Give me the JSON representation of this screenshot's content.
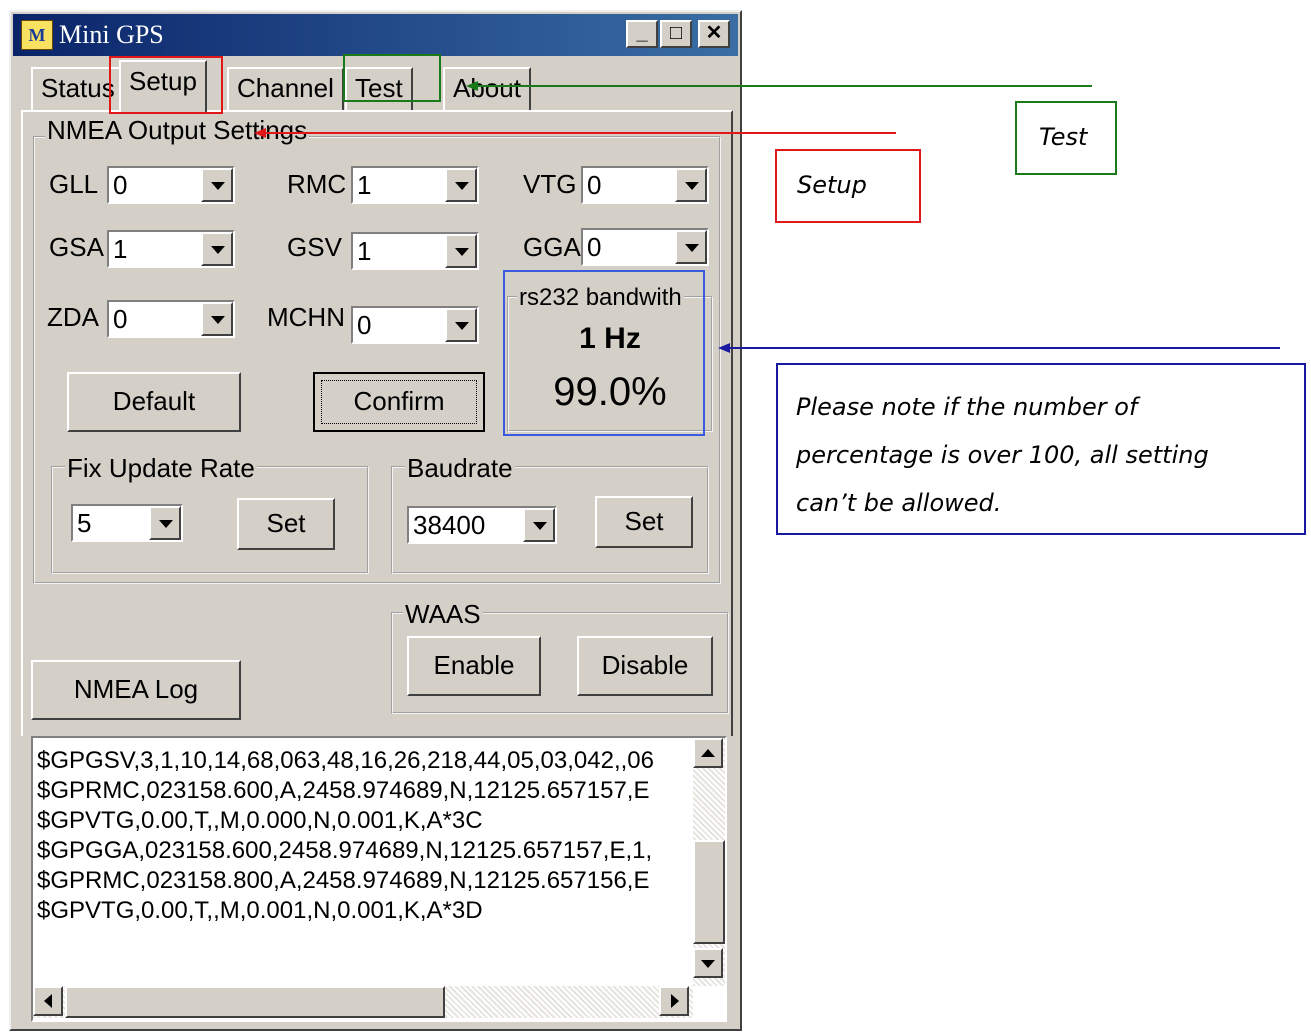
{
  "window": {
    "title": "Mini GPS",
    "minimize": "_",
    "maximize": "□",
    "close": "✕"
  },
  "tabs": [
    {
      "label": "Status"
    },
    {
      "label": "Setup"
    },
    {
      "label": "Channel"
    },
    {
      "label": "Test"
    },
    {
      "label": "About"
    }
  ],
  "nmea": {
    "title": "NMEA Output Settings",
    "fields": [
      {
        "label": "GLL",
        "value": "0"
      },
      {
        "label": "RMC",
        "value": "1"
      },
      {
        "label": "VTG",
        "value": "0"
      },
      {
        "label": "GSA",
        "value": "1"
      },
      {
        "label": "GSV",
        "value": "1"
      },
      {
        "label": "GGA",
        "value": "0"
      },
      {
        "label": "ZDA",
        "value": "0"
      },
      {
        "label": "MCHN",
        "value": "0"
      }
    ],
    "default_label": "Default",
    "confirm_label": "Confirm"
  },
  "bandwidth": {
    "title": "rs232 bandwith",
    "rate": "1 Hz",
    "percent": "99.0%"
  },
  "fix_update": {
    "title": "Fix Update Rate",
    "value": "5",
    "set_label": "Set"
  },
  "baudrate": {
    "title": "Baudrate",
    "value": "38400",
    "set_label": "Set"
  },
  "waas": {
    "title": "WAAS",
    "enable_label": "Enable",
    "disable_label": "Disable"
  },
  "nmea_log_label": "NMEA Log",
  "log_lines": [
    "$GPGSV,3,1,10,14,68,063,48,16,26,218,44,05,03,042,,06",
    "$GPRMC,023158.600,A,2458.974689,N,12125.657157,E",
    "$GPVTG,0.00,T,,M,0.000,N,0.001,K,A*3C",
    "$GPGGA,023158.600,2458.974689,N,12125.657157,E,1,",
    "$GPRMC,023158.800,A,2458.974689,N,12125.657156,E",
    "$GPVTG,0.00,T,,M,0.001,N,0.001,K,A*3D"
  ],
  "callouts": {
    "test": "Test",
    "setup": "Setup",
    "note": [
      "Please note if the number of",
      "percentage is over 100, all setting",
      "can’t be allowed."
    ]
  },
  "colors": {
    "test": "#1a7a1a",
    "setup": "#e01818",
    "note": "#1a1aa0",
    "title_bar": "#0a246a"
  },
  "icons": {
    "app": "mini-gps-app-icon",
    "dropdown": "chevron-down-icon",
    "scroll_up": "arrow-up-icon",
    "scroll_down": "arrow-down-icon",
    "scroll_left": "arrow-left-icon",
    "scroll_right": "arrow-right-icon"
  }
}
